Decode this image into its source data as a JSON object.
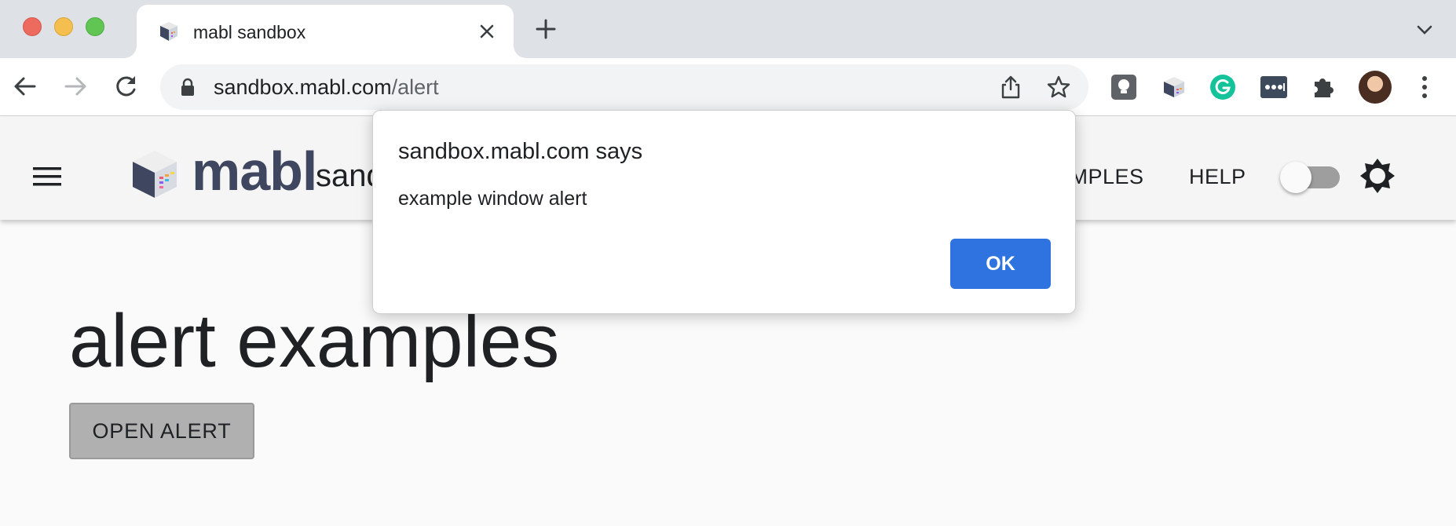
{
  "browser": {
    "tab": {
      "title": "mabl sandbox",
      "favicon": "mabl-cube-icon"
    },
    "new_tab_icon": "plus-icon",
    "tab_menu_icon": "chevron-down-icon",
    "address": {
      "host": "sandbox.mabl.com",
      "path": "/alert"
    },
    "extensions": [
      "lightbulb-extension-icon",
      "mabl-extension-icon",
      "grammarly-extension-icon",
      "password-manager-extension-icon",
      "puzzle-extensions-icon"
    ],
    "colors": {
      "tabstrip": "#dee1e6",
      "omnibox": "#f1f3f4"
    }
  },
  "app_bar": {
    "logo_text": "mabl",
    "logo_subtext": "sand",
    "nav": {
      "examples": "AMPLES",
      "help": "HELP"
    },
    "theme_toggle": {
      "on": false
    },
    "theme_icon": "brightness-icon"
  },
  "page": {
    "title": "alert examples",
    "open_alert_label": "OPEN ALERT"
  },
  "dialog": {
    "title": "sandbox.mabl.com says",
    "message": "example window alert",
    "ok_label": "OK",
    "colors": {
      "ok": "#2f73e0"
    }
  }
}
